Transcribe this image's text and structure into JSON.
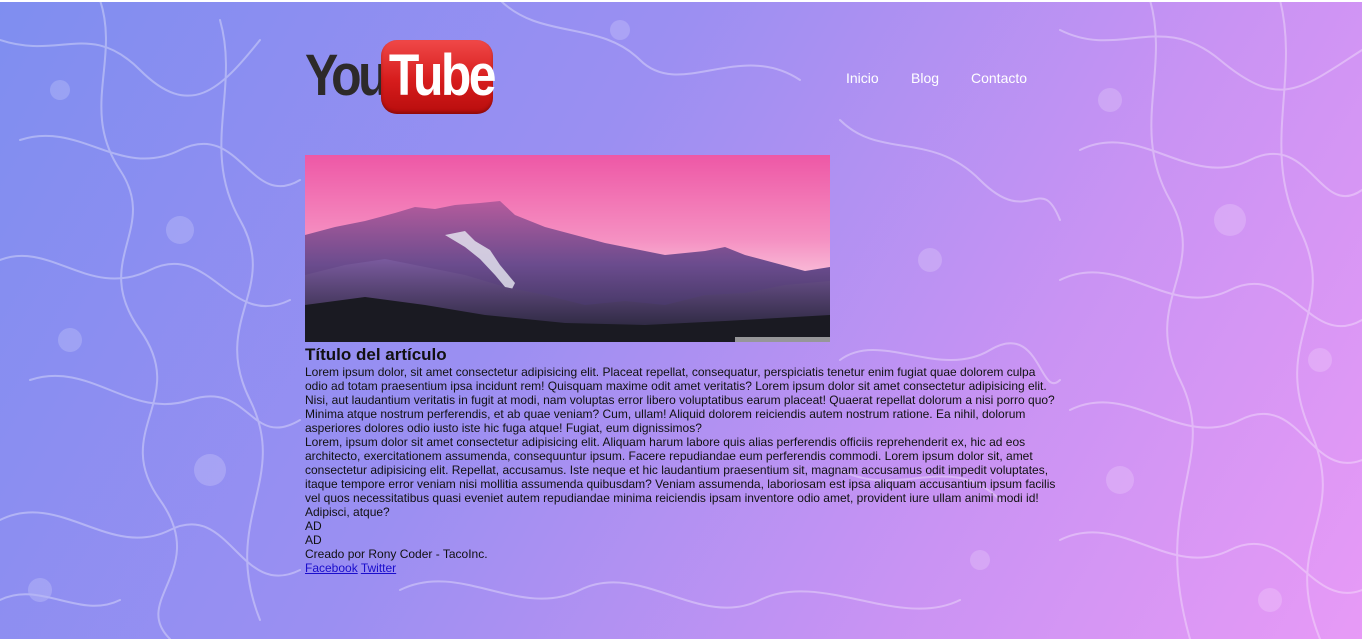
{
  "header": {
    "logo": {
      "word_you": "You",
      "word_tube": "Tube"
    },
    "nav": [
      {
        "label": "Inicio"
      },
      {
        "label": "Blog"
      },
      {
        "label": "Contacto"
      }
    ]
  },
  "article": {
    "title": "Título del artículo",
    "paragraphs": [
      "Lorem ipsum dolor, sit amet consectetur adipisicing elit. Placeat repellat, consequatur, perspiciatis tenetur enim fugiat quae dolorem culpa odio ad totam praesentium ipsa incidunt rem! Quisquam maxime odit amet veritatis? Lorem ipsum dolor sit amet consectetur adipisicing elit. Nisi, aut laudantium veritatis in fugit at modi, nam voluptas error libero voluptatibus earum placeat! Quaerat repellat dolorum a nisi porro quo? Minima atque nostrum perferendis, et ab quae veniam? Cum, ullam! Aliquid dolorem reiciendis autem nostrum ratione. Ea nihil, dolorum asperiores dolores odio iusto iste hic fuga atque! Fugiat, eum dignissimos?",
      "Lorem, ipsum dolor sit amet consectetur adipisicing elit. Aliquam harum labore quis alias perferendis officiis reprehenderit ex, hic ad eos architecto, exercitationem assumenda, consequuntur ipsum. Facere repudiandae eum perferendis commodi. Lorem ipsum dolor sit, amet consectetur adipisicing elit. Repellat, accusamus. Iste neque et hic laudantium praesentium sit, magnam accusamus odit impedit voluptates, itaque tempore error veniam nisi mollitia assumenda quibusdam? Veniam assumenda, laboriosam est ipsa aliquam accusantium ipsum facilis vel quos necessitatibus quasi eveniet autem repudiandae minima reiciendis ipsam inventore odio amet, provident iure ullam animi modi id! Adipisci, atque?"
    ],
    "ad_1": "AD",
    "ad_2": "AD"
  },
  "footer": {
    "credit": "Creado por Rony Coder - TacoInc.",
    "links": [
      {
        "label": "Facebook"
      },
      {
        "label": "Twitter"
      }
    ]
  },
  "colors": {
    "background_start": "#7f8ef0",
    "background_end": "#e79af6",
    "logo_red": "#d61c1c",
    "link": "#1a0dcc",
    "nav_text": "#ffffff"
  }
}
